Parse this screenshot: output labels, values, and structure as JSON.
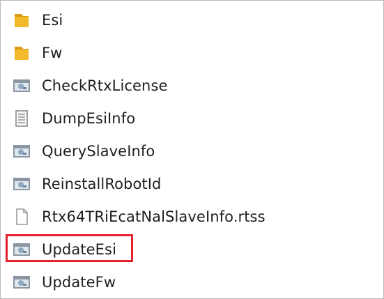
{
  "files": [
    {
      "name": "Esi",
      "icon": "folder-icon",
      "highlighted": false
    },
    {
      "name": "Fw",
      "icon": "folder-icon",
      "highlighted": false
    },
    {
      "name": "CheckRtxLicense",
      "icon": "application-icon",
      "highlighted": false
    },
    {
      "name": "DumpEsiInfo",
      "icon": "text-document-icon",
      "highlighted": false
    },
    {
      "name": "QuerySlaveInfo",
      "icon": "application-icon",
      "highlighted": false
    },
    {
      "name": "ReinstallRobotId",
      "icon": "application-icon",
      "highlighted": false
    },
    {
      "name": "Rtx64TRiEcatNalSlaveInfo.rtss",
      "icon": "blank-file-icon",
      "highlighted": false
    },
    {
      "name": "UpdateEsi",
      "icon": "application-icon",
      "highlighted": true
    },
    {
      "name": "UpdateFw",
      "icon": "application-icon",
      "highlighted": false
    }
  ],
  "colors": {
    "folder": "#f2b92b",
    "folder_dark": "#d79b14",
    "highlight": "#e5202d",
    "app_frame": "#8c96a3",
    "app_window": "#dfe7ef",
    "app_accent": "#8ea8bf"
  }
}
